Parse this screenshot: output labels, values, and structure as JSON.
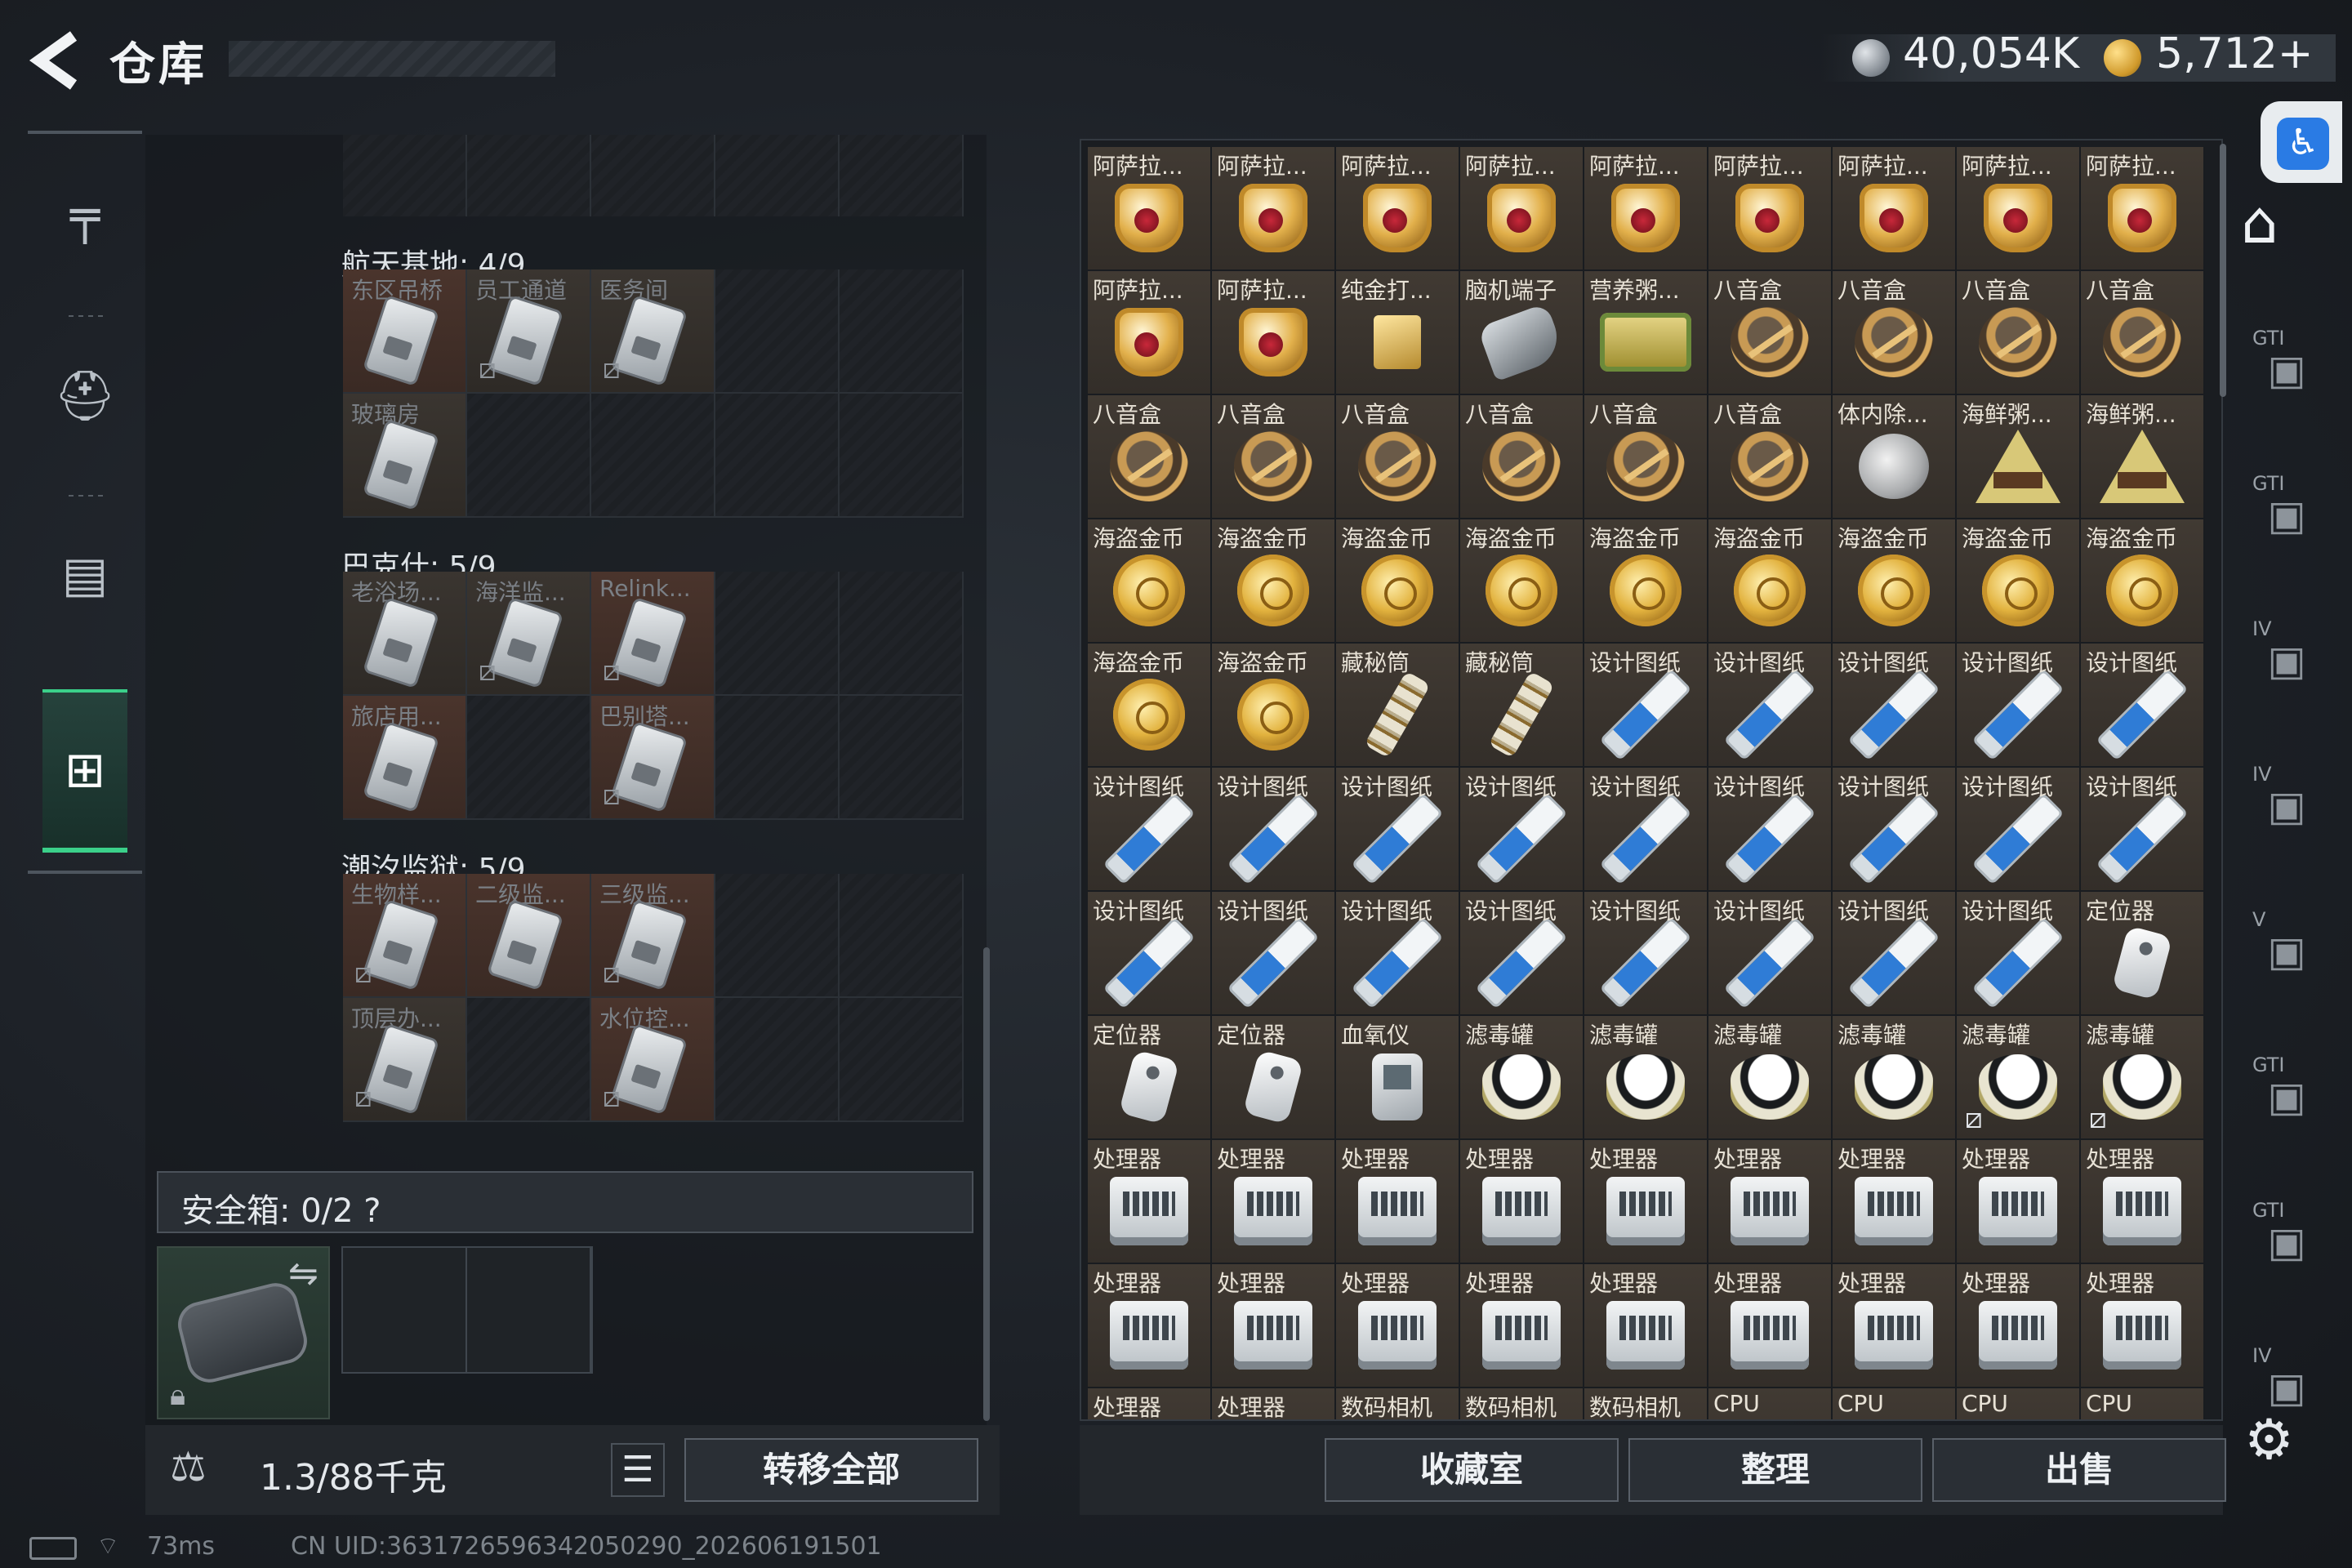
{
  "header": {
    "title": "仓库",
    "currency1": "40,054K",
    "currency2": "5,712+"
  },
  "side_tabs": [
    "weapon-tab",
    "backpack-tab",
    "vest-tab",
    "case-tab"
  ],
  "left": {
    "sections": [
      {
        "title": "航天基地: 4/9",
        "rows": [
          [
            {
              "label": "东区吊桥",
              "red": true
            },
            {
              "label": "员工通道",
              "bk": true
            },
            {
              "label": "医务间",
              "bk": true
            },
            {},
            {}
          ],
          [
            {
              "label": "玻璃房"
            },
            {},
            {},
            {},
            {}
          ]
        ]
      },
      {
        "title": "巴克什: 5/9",
        "rows": [
          [
            {
              "label": "老浴场..."
            },
            {
              "label": "海洋监...",
              "bk": true
            },
            {
              "label": "Relink...",
              "red": true,
              "bk": true
            },
            {},
            {}
          ],
          [
            {
              "label": "旅店用...",
              "red": true
            },
            {},
            {
              "label": "巴别塔...",
              "red": true,
              "bk": true
            },
            {},
            {}
          ]
        ]
      },
      {
        "title": "潮汐监狱: 5/9",
        "rows": [
          [
            {
              "label": "生物样...",
              "red": true,
              "bk": true
            },
            {
              "label": "二级监...",
              "red": true
            },
            {
              "label": "三级监...",
              "red": true,
              "bk": true
            },
            {},
            {}
          ],
          [
            {
              "label": "顶层办...",
              "bk": true
            },
            {},
            {
              "label": "水位控...",
              "red": true,
              "bk": true
            },
            {},
            {}
          ]
        ]
      }
    ],
    "safebox_label": "安全箱: 0/2  ?",
    "weight": "1.3/88千克",
    "transfer_label": "转移全部"
  },
  "right": {
    "items": [
      [
        "阿萨拉...",
        "cup"
      ],
      [
        "阿萨拉...",
        "cup"
      ],
      [
        "阿萨拉...",
        "cup"
      ],
      [
        "阿萨拉...",
        "cup"
      ],
      [
        "阿萨拉...",
        "cup"
      ],
      [
        "阿萨拉...",
        "cup"
      ],
      [
        "阿萨拉...",
        "cup"
      ],
      [
        "阿萨拉...",
        "cup"
      ],
      [
        "阿萨拉...",
        "cup"
      ],
      [
        "阿萨拉...",
        "cup"
      ],
      [
        "阿萨拉...",
        "cup"
      ],
      [
        "纯金打...",
        "lighter"
      ],
      [
        "脑机端子",
        "terminal"
      ],
      [
        "营养粥...",
        "tin"
      ],
      [
        "八音盒",
        "music"
      ],
      [
        "八音盒",
        "music"
      ],
      [
        "八音盒",
        "music"
      ],
      [
        "八音盒",
        "music"
      ],
      [
        "八音盒",
        "music"
      ],
      [
        "八音盒",
        "music"
      ],
      [
        "八音盒",
        "music"
      ],
      [
        "八音盒",
        "music"
      ],
      [
        "八音盒",
        "music"
      ],
      [
        "八音盒",
        "music"
      ],
      [
        "体内除...",
        "watch"
      ],
      [
        "海鲜粥...",
        "pyramid"
      ],
      [
        "海鲜粥...",
        "pyramid"
      ],
      [
        "海盗金币",
        "gcoin"
      ],
      [
        "海盗金币",
        "gcoin"
      ],
      [
        "海盗金币",
        "gcoin"
      ],
      [
        "海盗金币",
        "gcoin"
      ],
      [
        "海盗金币",
        "gcoin"
      ],
      [
        "海盗金币",
        "gcoin"
      ],
      [
        "海盗金币",
        "gcoin"
      ],
      [
        "海盗金币",
        "gcoin"
      ],
      [
        "海盗金币",
        "gcoin"
      ],
      [
        "海盗金币",
        "gcoin"
      ],
      [
        "海盗金币",
        "gcoin"
      ],
      [
        "藏秘筒",
        "cryptex"
      ],
      [
        "藏秘筒",
        "cryptex"
      ],
      [
        "设计图纸",
        "blueprint"
      ],
      [
        "设计图纸",
        "blueprint"
      ],
      [
        "设计图纸",
        "blueprint"
      ],
      [
        "设计图纸",
        "blueprint"
      ],
      [
        "设计图纸",
        "blueprint"
      ],
      [
        "设计图纸",
        "blueprint"
      ],
      [
        "设计图纸",
        "blueprint"
      ],
      [
        "设计图纸",
        "blueprint"
      ],
      [
        "设计图纸",
        "blueprint"
      ],
      [
        "设计图纸",
        "blueprint"
      ],
      [
        "设计图纸",
        "blueprint"
      ],
      [
        "设计图纸",
        "blueprint"
      ],
      [
        "设计图纸",
        "blueprint"
      ],
      [
        "设计图纸",
        "blueprint"
      ],
      [
        "设计图纸",
        "blueprint"
      ],
      [
        "设计图纸",
        "blueprint"
      ],
      [
        "设计图纸",
        "blueprint"
      ],
      [
        "设计图纸",
        "blueprint"
      ],
      [
        "设计图纸",
        "blueprint"
      ],
      [
        "设计图纸",
        "blueprint"
      ],
      [
        "设计图纸",
        "blueprint"
      ],
      [
        "设计图纸",
        "blueprint"
      ],
      [
        "定位器",
        "locator"
      ],
      [
        "定位器",
        "locator"
      ],
      [
        "定位器",
        "locator"
      ],
      [
        "血氧仪",
        "bloodox"
      ],
      [
        "滤毒罐",
        "filter"
      ],
      [
        "滤毒罐",
        "filter"
      ],
      [
        "滤毒罐",
        "filter"
      ],
      [
        "滤毒罐",
        "filter"
      ],
      [
        "滤毒罐",
        "filter",
        true
      ],
      [
        "滤毒罐",
        "filter",
        true
      ],
      [
        "处理器",
        "cpu"
      ],
      [
        "处理器",
        "cpu"
      ],
      [
        "处理器",
        "cpu"
      ],
      [
        "处理器",
        "cpu"
      ],
      [
        "处理器",
        "cpu"
      ],
      [
        "处理器",
        "cpu"
      ],
      [
        "处理器",
        "cpu"
      ],
      [
        "处理器",
        "cpu"
      ],
      [
        "处理器",
        "cpu"
      ],
      [
        "处理器",
        "cpu"
      ],
      [
        "处理器",
        "cpu"
      ],
      [
        "处理器",
        "cpu"
      ],
      [
        "处理器",
        "cpu"
      ],
      [
        "处理器",
        "cpu"
      ],
      [
        "处理器",
        "cpu"
      ],
      [
        "处理器",
        "cpu"
      ],
      [
        "处理器",
        "cpu"
      ],
      [
        "处理器",
        "cpu"
      ],
      [
        "处理器",
        "cpu"
      ],
      [
        "处理器",
        "cpu"
      ],
      [
        "数码相机",
        "cpu"
      ],
      [
        "数码相机",
        "cpu"
      ],
      [
        "数码相机",
        "cpu"
      ],
      [
        "CPU",
        "cpu"
      ],
      [
        "CPU",
        "cpu"
      ],
      [
        "CPU",
        "cpu"
      ],
      [
        "CPU",
        "cpu"
      ]
    ],
    "collection_label": "收藏室",
    "sort_label": "整理",
    "sell_label": "出售"
  },
  "right_sidebar": [
    {
      "label": "",
      "icon": "home-icon"
    },
    {
      "label": "GTI",
      "icon": "grid-icon"
    },
    {
      "label": "GTI",
      "icon": "ship-icon"
    },
    {
      "label": "IV",
      "icon": "box-icon"
    },
    {
      "label": "IV",
      "icon": "medkit-icon"
    },
    {
      "label": "V",
      "icon": "camera-icon"
    },
    {
      "label": "GTI",
      "icon": "tools-icon"
    },
    {
      "label": "GTI",
      "icon": "vehicle-icon"
    },
    {
      "label": "IV",
      "icon": "more-icon"
    }
  ],
  "status": {
    "ping": "73ms",
    "uid": "CN UID:3631726596342050290_202606191501"
  }
}
